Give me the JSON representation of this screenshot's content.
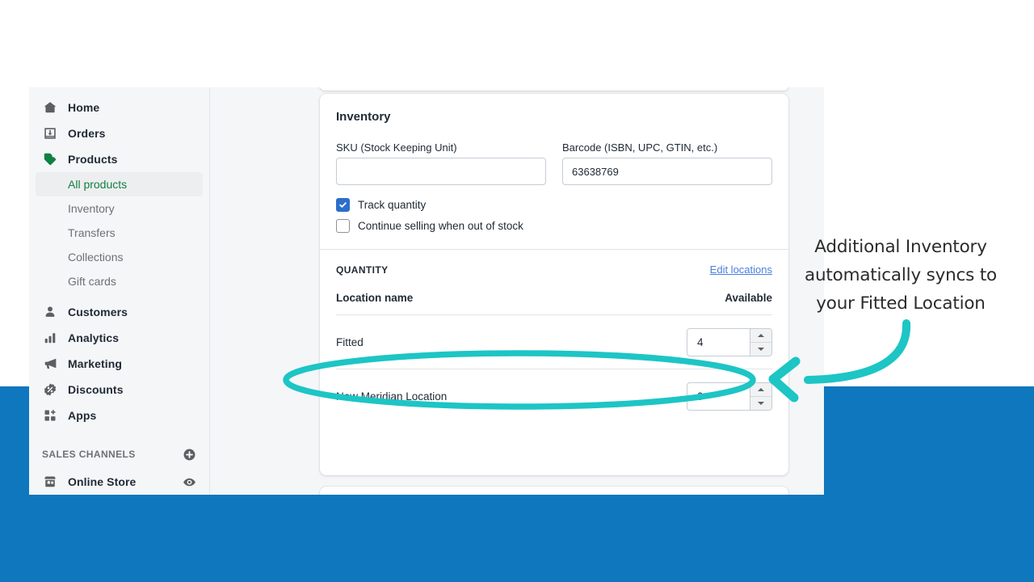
{
  "theme": {
    "teal_accent": "#1dc5c5",
    "blue_backdrop": "#0f77be",
    "brand_green": "#108043",
    "link_blue": "#4a7fe0",
    "checkbox_blue": "#2c6ecb",
    "content_bg": "#f4f6f8",
    "card_bg": "#ffffff",
    "text_primary": "#212b36",
    "text_subdued": "#6d7175"
  },
  "sidebar": {
    "items": [
      {
        "label": "Home",
        "icon": "home-icon"
      },
      {
        "label": "Orders",
        "icon": "orders-inbox-icon"
      },
      {
        "label": "Products",
        "icon": "tag-icon"
      }
    ],
    "product_subitems": [
      {
        "label": "All products",
        "active": true
      },
      {
        "label": "Inventory",
        "active": false
      },
      {
        "label": "Transfers",
        "active": false
      },
      {
        "label": "Collections",
        "active": false
      },
      {
        "label": "Gift cards",
        "active": false
      }
    ],
    "items_lower": [
      {
        "label": "Customers",
        "icon": "person-icon"
      },
      {
        "label": "Analytics",
        "icon": "bar-chart-icon"
      },
      {
        "label": "Marketing",
        "icon": "megaphone-icon"
      },
      {
        "label": "Discounts",
        "icon": "discount-badge-icon"
      },
      {
        "label": "Apps",
        "icon": "apps-grid-icon"
      }
    ],
    "sales_channels": {
      "header": "SALES CHANNELS",
      "add_icon": "plus-circle-icon",
      "items": [
        {
          "label": "Online Store",
          "icon": "storefront-icon",
          "trailing_icon": "eye-icon"
        }
      ]
    }
  },
  "inventory_card": {
    "title": "Inventory",
    "sku": {
      "label": "SKU (Stock Keeping Unit)",
      "value": "",
      "placeholder": ""
    },
    "barcode": {
      "label": "Barcode (ISBN, UPC, GTIN, etc.)",
      "value": "63638769",
      "placeholder": ""
    },
    "checkboxes": [
      {
        "label": "Track quantity",
        "checked": true
      },
      {
        "label": "Continue selling when out of stock",
        "checked": false
      }
    ],
    "quantity_section": {
      "label": "QUANTITY",
      "edit_link": "Edit locations",
      "columns": {
        "name": "Location name",
        "available": "Available"
      },
      "rows": [
        {
          "location": "Fitted",
          "available": "4",
          "highlighted": true
        },
        {
          "location": "New Meridian Location",
          "available": "0",
          "highlighted": false
        }
      ]
    }
  },
  "annotation": {
    "line1": "Additional Inventory",
    "line2": "automatically syncs to",
    "line3": "your Fitted Location",
    "ellipse_label": "highlight-ellipse",
    "arrow_label": "curved-arrow"
  }
}
